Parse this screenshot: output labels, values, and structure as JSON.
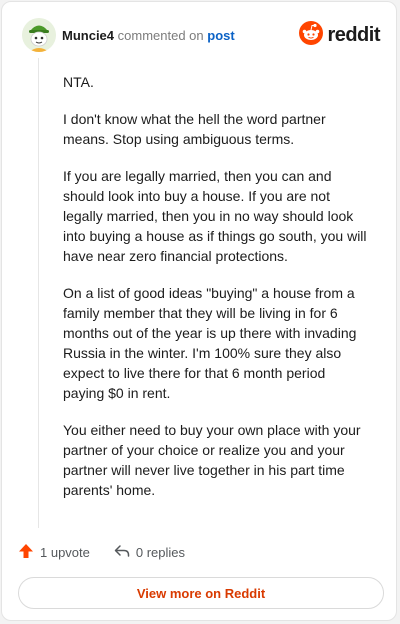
{
  "header": {
    "username": "Muncie4",
    "action_text": "commented on",
    "post_link": "post",
    "brand": "reddit",
    "brand_color": "#ff4500"
  },
  "comment": {
    "paragraphs": [
      "NTA.",
      "I don't know what the hell the word partner means. Stop using ambiguous terms.",
      "If you are legally married, then you can and should look into buy a house. If you are not legally married, then you in no way should look into buying a house as if things go south, you will have near zero financial protections.",
      "On a list of good ideas \"buying\" a house from a family member that they will be living in for 6 months out of the year is up there with invading Russia in the winter. I'm 100% sure they also expect to live there for that 6 month period paying $0 in rent.",
      "You either need to buy your own place with your partner of your choice or realize you and your partner will never live together in his part time parents' home."
    ]
  },
  "footer": {
    "upvotes": "1 upvote",
    "replies": "0 replies",
    "upvote_icon": "upvote-arrow-icon",
    "reply_icon": "reply-arrow-icon",
    "upvote_color": "#ff4500"
  },
  "cta": {
    "label": "View more on Reddit",
    "color": "#d93a00"
  }
}
